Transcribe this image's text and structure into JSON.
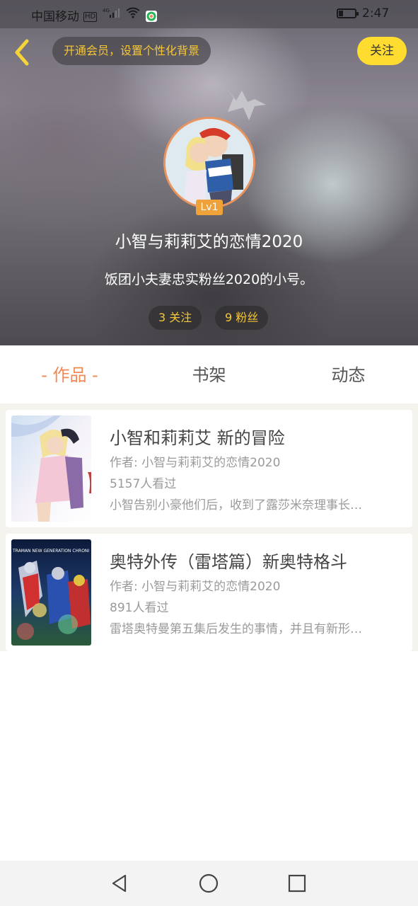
{
  "status_bar": {
    "carrier": "中国移动",
    "hd": "HD",
    "network": "4G",
    "time": "2:47"
  },
  "header": {
    "vip_prompt": "开通会员，设置个性化背景",
    "follow_label": "关注",
    "level": "Lv1",
    "username": "小智与莉莉艾的恋情2020",
    "bio": "饭团小夫妻忠实粉丝2020的小号。",
    "following": "3 关注",
    "fans": "9 粉丝"
  },
  "tabs": [
    {
      "label": "- 作品 -",
      "active": true
    },
    {
      "label": "书架",
      "active": false
    },
    {
      "label": "动态",
      "active": false
    }
  ],
  "works": [
    {
      "title": "小智和莉莉艾 新的冒险",
      "author": "作者: 小智与莉莉艾的恋情2020",
      "views": "5157人看过",
      "desc": "小智告别小豪他们后，收到了露莎米奈理事长…"
    },
    {
      "title": "奥特外传（雷塔篇）新奥特格斗",
      "author": "作者: 小智与莉莉艾的恋情2020",
      "views": "891人看过",
      "desc": "雷塔奥特曼第五集后发生的事情，并且有新形…",
      "cover_text": "TRAMAN NEW GENERATION CHRONI"
    }
  ],
  "colors": {
    "accent_orange": "#ef8a55",
    "follow_yellow": "#ffdc2f",
    "gold_text": "#f5c736",
    "level_badge": "#f0a23a"
  },
  "icons": {
    "back": "chevron-left-icon",
    "nav_back": "triangle-back-icon",
    "nav_home": "circle-home-icon",
    "nav_recent": "square-recent-icon"
  }
}
